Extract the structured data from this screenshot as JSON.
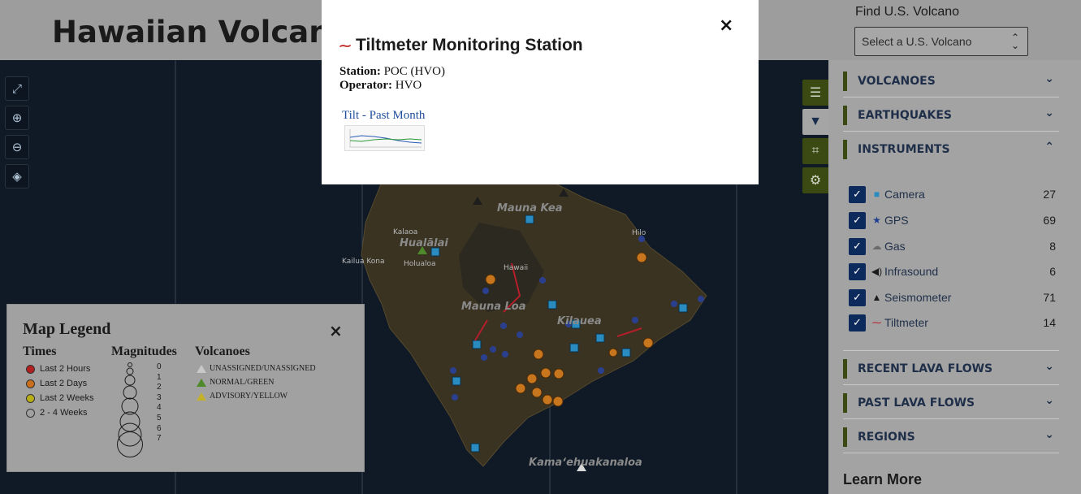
{
  "header": {
    "title": "Hawaiian Volcano O",
    "find_label": "Find U.S. Volcano",
    "select_placeholder": "Select a U.S. Volcano"
  },
  "map": {
    "tools": [
      {
        "name": "fullscreen-icon",
        "glyph": "⤢"
      },
      {
        "name": "zoom-in-icon",
        "glyph": "⊕"
      },
      {
        "name": "zoom-out-icon",
        "glyph": "⊖"
      },
      {
        "name": "compass-icon",
        "glyph": "◈"
      }
    ],
    "side_buttons": [
      {
        "name": "list-icon",
        "glyph": "☰"
      },
      {
        "name": "filter-icon",
        "glyph": "▼"
      },
      {
        "name": "crop-icon",
        "glyph": "⌗"
      },
      {
        "name": "settings-icon",
        "glyph": "⚙"
      }
    ],
    "labels": {
      "mauna_kea": "Mauna Kea",
      "hualalai": "Hualālai",
      "kilauea": "Kīlauea",
      "mauna_loa": "Mauna Loa",
      "kamaehuakanaloa": "Kamaʻehuakanaloa",
      "kalaoa": "Kalaoa",
      "kailua_kona": "Kailua Kona",
      "holualoa": "Holualoa",
      "hawaii": "Hawaii",
      "hilo": "Hilo"
    }
  },
  "popup": {
    "title": "Tiltmeter Monitoring Station",
    "close": "×",
    "station_label": "Station:",
    "station_value": "POC (HVO)",
    "operator_label": "Operator:",
    "operator_value": "HVO",
    "link": "Tilt - Past Month"
  },
  "legend": {
    "title": "Map Legend",
    "close": "×",
    "times_heading": "Times",
    "times": [
      {
        "label": "Last 2 Hours",
        "color": "#b21f1f"
      },
      {
        "label": "Last 2 Days",
        "color": "#c96e1a"
      },
      {
        "label": "Last 2 Weeks",
        "color": "#b8ae17"
      },
      {
        "label": "2 - 4 Weeks",
        "color": "#a1a1a1"
      }
    ],
    "magnitudes_heading": "Magnitudes",
    "magnitudes": [
      "0",
      "1",
      "2",
      "3",
      "4",
      "5",
      "6",
      "7"
    ],
    "volcanoes_heading": "Volcanoes",
    "volcanoes": [
      {
        "label": "UNASSIGNED/UNASSIGNED",
        "color": "#a1a1a1"
      },
      {
        "label": "NORMAL/GREEN",
        "color": "#4e8a2a"
      },
      {
        "label": "ADVISORY/YELLOW",
        "color": "#c2b22b"
      }
    ]
  },
  "panel": {
    "sections": {
      "volcanoes": "VOLCANOES",
      "earthquakes": "EARTHQUAKES",
      "instruments": "INSTRUMENTS",
      "recent_lava": "RECENT LAVA FLOWS",
      "past_lava": "PAST LAVA FLOWS",
      "regions": "REGIONS"
    },
    "instruments": [
      {
        "label": "Camera",
        "count": "27",
        "icon": "■",
        "name": "camera-icon"
      },
      {
        "label": "GPS",
        "count": "69",
        "icon": "★",
        "name": "gps-star-icon"
      },
      {
        "label": "Gas",
        "count": "8",
        "icon": "☁",
        "name": "gas-cloud-icon"
      },
      {
        "label": "Infrasound",
        "count": "6",
        "icon": "🔊",
        "name": "infrasound-speaker-icon"
      },
      {
        "label": "Seismometer",
        "count": "71",
        "icon": "▲",
        "name": "seismometer-triangle-icon"
      },
      {
        "label": "Tiltmeter",
        "count": "14",
        "icon": "⁓",
        "name": "tiltmeter-icon"
      }
    ],
    "learn_more": "Learn More"
  }
}
